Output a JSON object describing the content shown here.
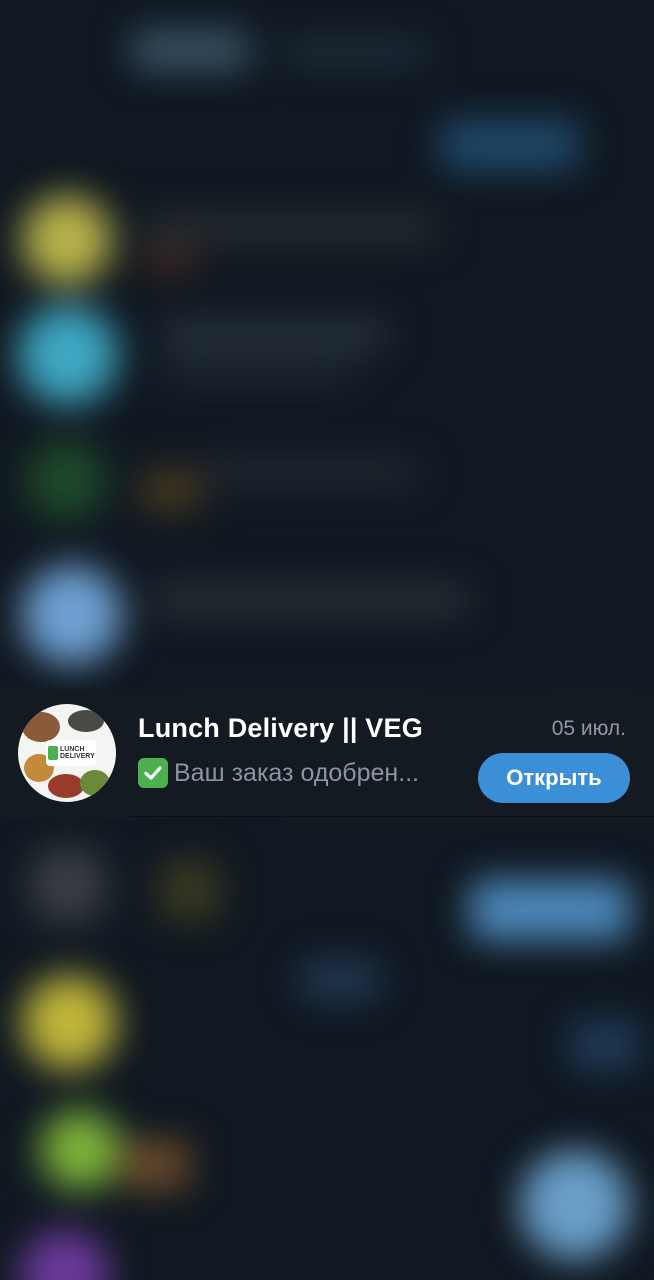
{
  "chat": {
    "title": "Lunch Delivery || VEG",
    "date": "05 июл.",
    "preview_text": "Ваш заказ одобрен...",
    "preview_icon": "check-mark-icon",
    "open_button_label": "Открыть",
    "avatar_logo_line1": "LUNCH",
    "avatar_logo_line2": "DELIVERY"
  },
  "colors": {
    "background": "#101821",
    "button": "#3b8fd6",
    "title": "#ffffff",
    "muted": "#8b959f",
    "check": "#4caf50"
  }
}
